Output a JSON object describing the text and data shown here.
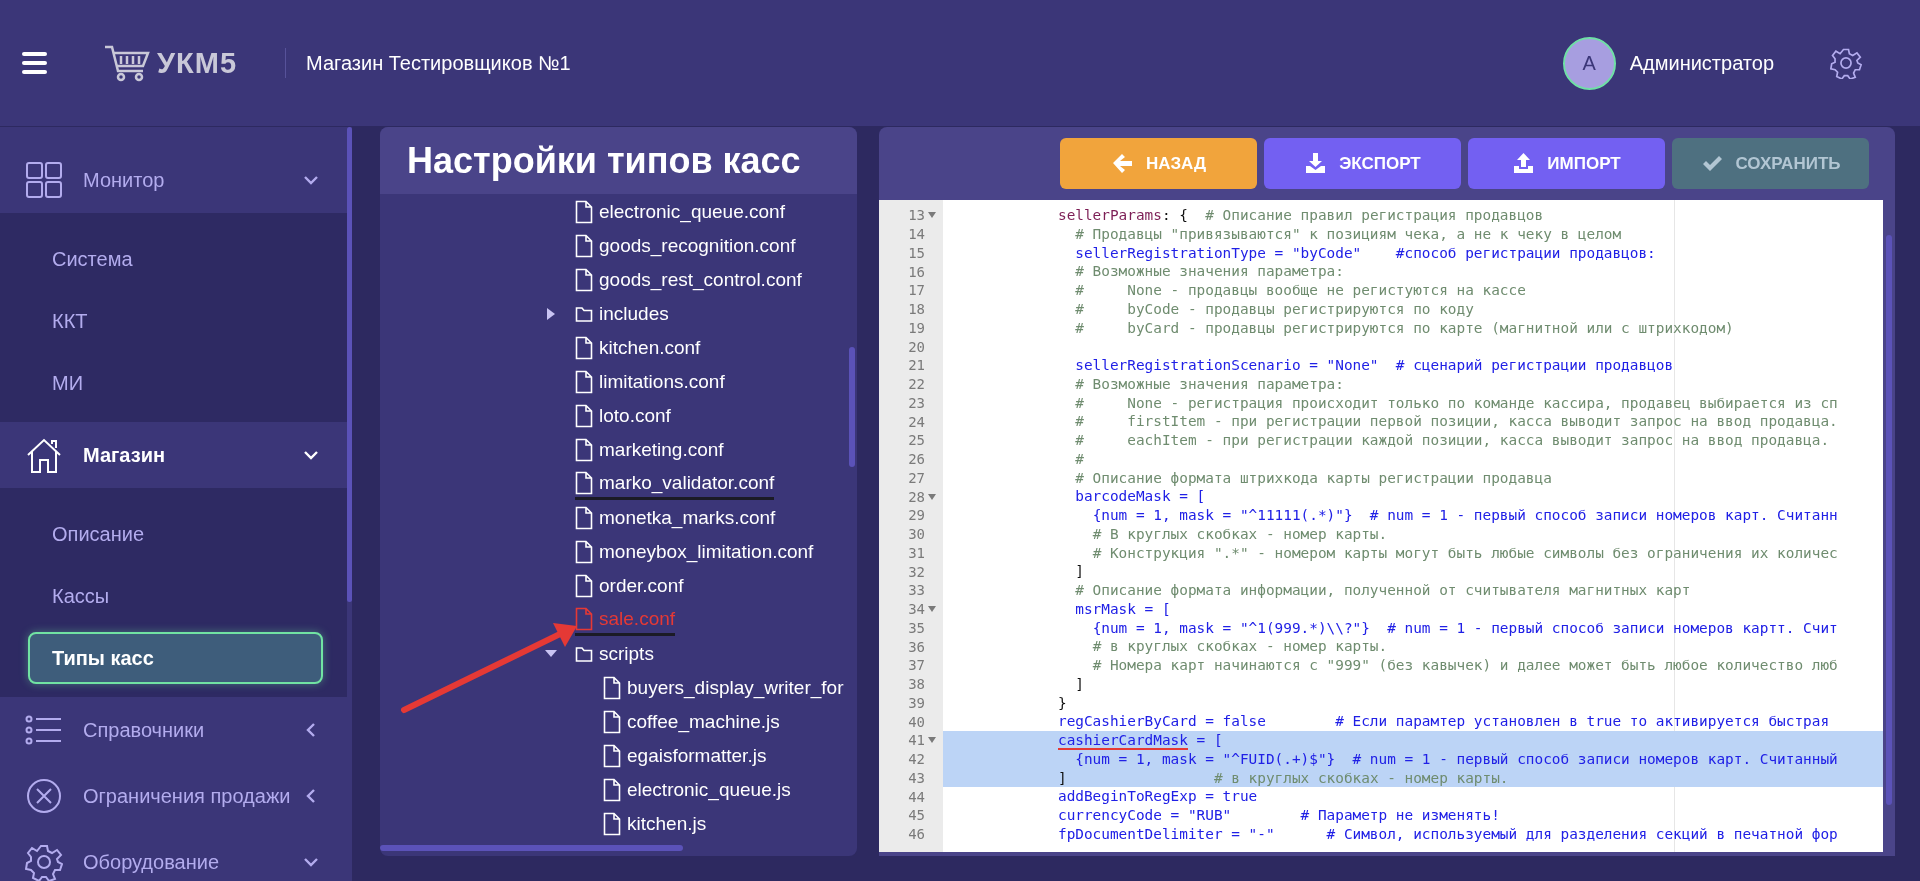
{
  "header": {
    "logo": "УКМ5",
    "store": "Магазин Тестировщиков №1",
    "user": {
      "initial": "А",
      "name": "Администратор"
    }
  },
  "sidebar": {
    "sections": [
      {
        "label": "Монитор",
        "expanded": true,
        "selected": false,
        "children": [
          {
            "label": "Система",
            "selected": false
          },
          {
            "label": "ККТ",
            "selected": false
          },
          {
            "label": "МИ",
            "selected": false
          }
        ]
      },
      {
        "label": "Магазин",
        "expanded": true,
        "selected": true,
        "children": [
          {
            "label": "Описание",
            "selected": false
          },
          {
            "label": "Кассы",
            "selected": false
          },
          {
            "label": "Типы касс",
            "selected": true
          }
        ]
      },
      {
        "label": "Справочники",
        "expanded": false,
        "selected": false
      },
      {
        "label": "Ограничения продажи",
        "expanded": false,
        "selected": false
      },
      {
        "label": "Оборудование",
        "expanded": true,
        "selected": false
      }
    ]
  },
  "tree": {
    "title": "Настройки типов касс",
    "items": [
      {
        "name": "electronic_queue.conf",
        "kind": "file",
        "selected": false,
        "underlined": false
      },
      {
        "name": "goods_recognition.conf",
        "kind": "file",
        "selected": false,
        "underlined": false
      },
      {
        "name": "goods_rest_control.conf",
        "kind": "file",
        "selected": false,
        "underlined": false
      },
      {
        "name": "includes",
        "kind": "folder",
        "expanded": false,
        "selected": false,
        "underlined": false
      },
      {
        "name": "kitchen.conf",
        "kind": "file",
        "selected": false,
        "underlined": false
      },
      {
        "name": "limitations.conf",
        "kind": "file",
        "selected": false,
        "underlined": false
      },
      {
        "name": "loto.conf",
        "kind": "file",
        "selected": false,
        "underlined": false
      },
      {
        "name": "marketing.conf",
        "kind": "file",
        "selected": false,
        "underlined": false
      },
      {
        "name": "marko_validator.conf",
        "kind": "file",
        "selected": false,
        "underlined": true
      },
      {
        "name": "monetka_marks.conf",
        "kind": "file",
        "selected": false,
        "underlined": false
      },
      {
        "name": "moneybox_limitation.conf",
        "kind": "file",
        "selected": false,
        "underlined": false
      },
      {
        "name": "order.conf",
        "kind": "file",
        "selected": false,
        "underlined": false
      },
      {
        "name": "sale.conf",
        "kind": "file",
        "selected": true,
        "underlined": true
      },
      {
        "name": "scripts",
        "kind": "folder",
        "expanded": true,
        "selected": false,
        "underlined": false,
        "children": [
          {
            "name": "buyers_display_writer_for",
            "kind": "file",
            "selected": false,
            "underlined": false
          },
          {
            "name": "coffee_machine.js",
            "kind": "file",
            "selected": false,
            "underlined": false
          },
          {
            "name": "egaisformatter.js",
            "kind": "file",
            "selected": false,
            "underlined": false
          },
          {
            "name": "electronic_queue.js",
            "kind": "file",
            "selected": false,
            "underlined": false
          },
          {
            "name": "kitchen.js",
            "kind": "file",
            "selected": false,
            "underlined": false
          }
        ]
      }
    ]
  },
  "toolbar": {
    "buttons": [
      {
        "label": "НАЗАД",
        "kind": "back",
        "disabled": false
      },
      {
        "label": "ЭКСПОРТ",
        "kind": "export",
        "disabled": false
      },
      {
        "label": "ИМПОРТ",
        "kind": "import",
        "disabled": false
      },
      {
        "label": "СОХРАНИТЬ",
        "kind": "save",
        "disabled": true
      }
    ]
  },
  "editor": {
    "lines": [
      {
        "number": "13",
        "foldable": true,
        "selected": false,
        "segments": [
          {
            "kind": "key",
            "text": "            sellerParams",
            "underlined": false
          },
          {
            "kind": "plain",
            "text": ": {",
            "underlined": false
          },
          {
            "kind": "comment",
            "text": "  # Описание правил регистрация продавцов",
            "underlined": false
          }
        ]
      },
      {
        "number": "14",
        "foldable": false,
        "selected": false,
        "segments": [
          {
            "kind": "comment",
            "text": "              # Продавцы \"привязываются\" к позициям чека, а не к чеку в целом",
            "underlined": false
          }
        ]
      },
      {
        "number": "15",
        "foldable": false,
        "selected": false,
        "segments": [
          {
            "kind": "value",
            "text": "              sellerRegistrationType = \"byCode\"    #способ регистрации продавцов:",
            "underlined": false
          }
        ]
      },
      {
        "number": "16",
        "foldable": false,
        "selected": false,
        "segments": [
          {
            "kind": "comment",
            "text": "              # Возможные значения параметра:",
            "underlined": false
          }
        ]
      },
      {
        "number": "17",
        "foldable": false,
        "selected": false,
        "segments": [
          {
            "kind": "comment",
            "text": "              #     None - продавцы вообще не регистуются на кассе",
            "underlined": false
          }
        ]
      },
      {
        "number": "18",
        "foldable": false,
        "selected": false,
        "segments": [
          {
            "kind": "comment",
            "text": "              #     byCode - продавцы регистрируются по коду",
            "underlined": false
          }
        ]
      },
      {
        "number": "19",
        "foldable": false,
        "selected": false,
        "segments": [
          {
            "kind": "comment",
            "text": "              #     byCard - продавцы регистрируются по карте (магнитной или с штрихкодом)",
            "underlined": false
          }
        ]
      },
      {
        "number": "20",
        "foldable": false,
        "selected": false
      },
      {
        "number": "21",
        "foldable": false,
        "selected": false,
        "segments": [
          {
            "kind": "value",
            "text": "              sellerRegistrationScenario = \"None\"  # сценарий регистрации продавцов",
            "underlined": false
          }
        ]
      },
      {
        "number": "22",
        "foldable": false,
        "selected": false,
        "segments": [
          {
            "kind": "comment",
            "text": "              # Возможные значения параметра:",
            "underlined": false
          }
        ]
      },
      {
        "number": "23",
        "foldable": false,
        "selected": false,
        "segments": [
          {
            "kind": "comment",
            "text": "              #     None - регистрация происходит только по команде кассира, продавец выбирается из сп",
            "underlined": false
          }
        ]
      },
      {
        "number": "24",
        "foldable": false,
        "selected": false,
        "segments": [
          {
            "kind": "comment",
            "text": "              #     firstItem - при регистрации первой позиции, касса выводит запрос на ввод продавца.",
            "underlined": false
          }
        ]
      },
      {
        "number": "25",
        "foldable": false,
        "selected": false,
        "segments": [
          {
            "kind": "comment",
            "text": "              #     eachItem - при регистрации каждой позиции, касса выводит запрос на ввод продавца.",
            "underlined": false
          }
        ]
      },
      {
        "number": "26",
        "foldable": false,
        "selected": false,
        "segments": [
          {
            "kind": "comment",
            "text": "              #",
            "underlined": false
          }
        ]
      },
      {
        "number": "27",
        "foldable": false,
        "selected": false,
        "segments": [
          {
            "kind": "comment",
            "text": "              # Описание формата штрихкода карты регистрации продавца",
            "underlined": false
          }
        ]
      },
      {
        "number": "28",
        "foldable": true,
        "selected": false,
        "segments": [
          {
            "kind": "value",
            "text": "              barcodeMask = [",
            "underlined": false
          }
        ]
      },
      {
        "number": "29",
        "foldable": false,
        "selected": false,
        "segments": [
          {
            "kind": "value",
            "text": "                {num = 1, mask = \"^11111(.*)\"}  # num = 1 - первый способ записи номеров карт. Считанн",
            "underlined": false
          }
        ]
      },
      {
        "number": "30",
        "foldable": false,
        "selected": false,
        "segments": [
          {
            "kind": "comment",
            "text": "                # В круглых скобках - номер карты.",
            "underlined": false
          }
        ]
      },
      {
        "number": "31",
        "foldable": false,
        "selected": false,
        "segments": [
          {
            "kind": "comment",
            "text": "                # Конструкция \".*\" - номером карты могут быть любые символы без ограничения их количес",
            "underlined": false
          }
        ]
      },
      {
        "number": "32",
        "foldable": false,
        "selected": false,
        "segments": [
          {
            "kind": "plain",
            "text": "              ]",
            "underlined": false
          }
        ]
      },
      {
        "number": "33",
        "foldable": false,
        "selected": false,
        "segments": [
          {
            "kind": "comment",
            "text": "              # Описание формата информации, полученной от считывателя магнитных карт",
            "underlined": false
          }
        ]
      },
      {
        "number": "34",
        "foldable": true,
        "selected": false,
        "segments": [
          {
            "kind": "value",
            "text": "              msrMask = [",
            "underlined": false
          }
        ]
      },
      {
        "number": "35",
        "foldable": false,
        "selected": false,
        "segments": [
          {
            "kind": "value",
            "text": "                {num = 1, mask = \"^1(999.*)\\\\?\"}  # num = 1 - первый способ записи номеров картт. Счит",
            "underlined": false
          }
        ]
      },
      {
        "number": "36",
        "foldable": false,
        "selected": false,
        "segments": [
          {
            "kind": "comment",
            "text": "                # в круглых скобках - номер карты.",
            "underlined": false
          }
        ]
      },
      {
        "number": "37",
        "foldable": false,
        "selected": false,
        "segments": [
          {
            "kind": "comment",
            "text": "                # Номера карт начинаются с \"999\" (без кавычек) и далее может быть любое количество люб",
            "underlined": false
          }
        ]
      },
      {
        "number": "38",
        "foldable": false,
        "selected": false,
        "segments": [
          {
            "kind": "plain",
            "text": "              ]",
            "underlined": false
          }
        ]
      },
      {
        "number": "39",
        "foldable": false,
        "selected": false,
        "segments": [
          {
            "kind": "plain",
            "text": "            }",
            "underlined": false
          }
        ]
      },
      {
        "number": "40",
        "foldable": false,
        "selected": false,
        "segments": [
          {
            "kind": "value",
            "text": "            regCashierByCard = false        # Если парамтер установлен в true то активируется быстрая",
            "underlined": false
          }
        ]
      },
      {
        "number": "41",
        "foldable": true,
        "selected": true,
        "segments": [
          {
            "kind": "value",
            "text": "            cashierCardMask",
            "underlined": true
          },
          {
            "kind": "value",
            "text": " = [",
            "underlined": false
          }
        ]
      },
      {
        "number": "42",
        "foldable": false,
        "selected": true,
        "segments": [
          {
            "kind": "value",
            "text": "              {num = 1, mask = \"^FUID(.+)$\"}  # num = 1 - первый способ записи номеров карт. Считанный",
            "underlined": false
          }
        ]
      },
      {
        "number": "43",
        "foldable": false,
        "selected": true,
        "segments": [
          {
            "kind": "plain",
            "text": "            ]",
            "underlined": false
          },
          {
            "kind": "comment",
            "text": "                 # в круглых скобках - номер карты.",
            "underlined": false
          }
        ]
      },
      {
        "number": "44",
        "foldable": false,
        "selected": false,
        "segments": [
          {
            "kind": "value",
            "text": "            addBeginToRegExp = true",
            "underlined": false
          }
        ]
      },
      {
        "number": "45",
        "foldable": false,
        "selected": false,
        "segments": [
          {
            "kind": "value",
            "text": "            currencyCode = \"RUB\"        # Параметр не изменять!",
            "underlined": false
          }
        ]
      },
      {
        "number": "46",
        "foldable": false,
        "selected": false,
        "segments": [
          {
            "kind": "value",
            "text": "            fpDocumentDelimiter = \"-\"      # Символ, используемый для разделения секций в печатной фор",
            "underlined": false
          }
        ]
      }
    ]
  }
}
